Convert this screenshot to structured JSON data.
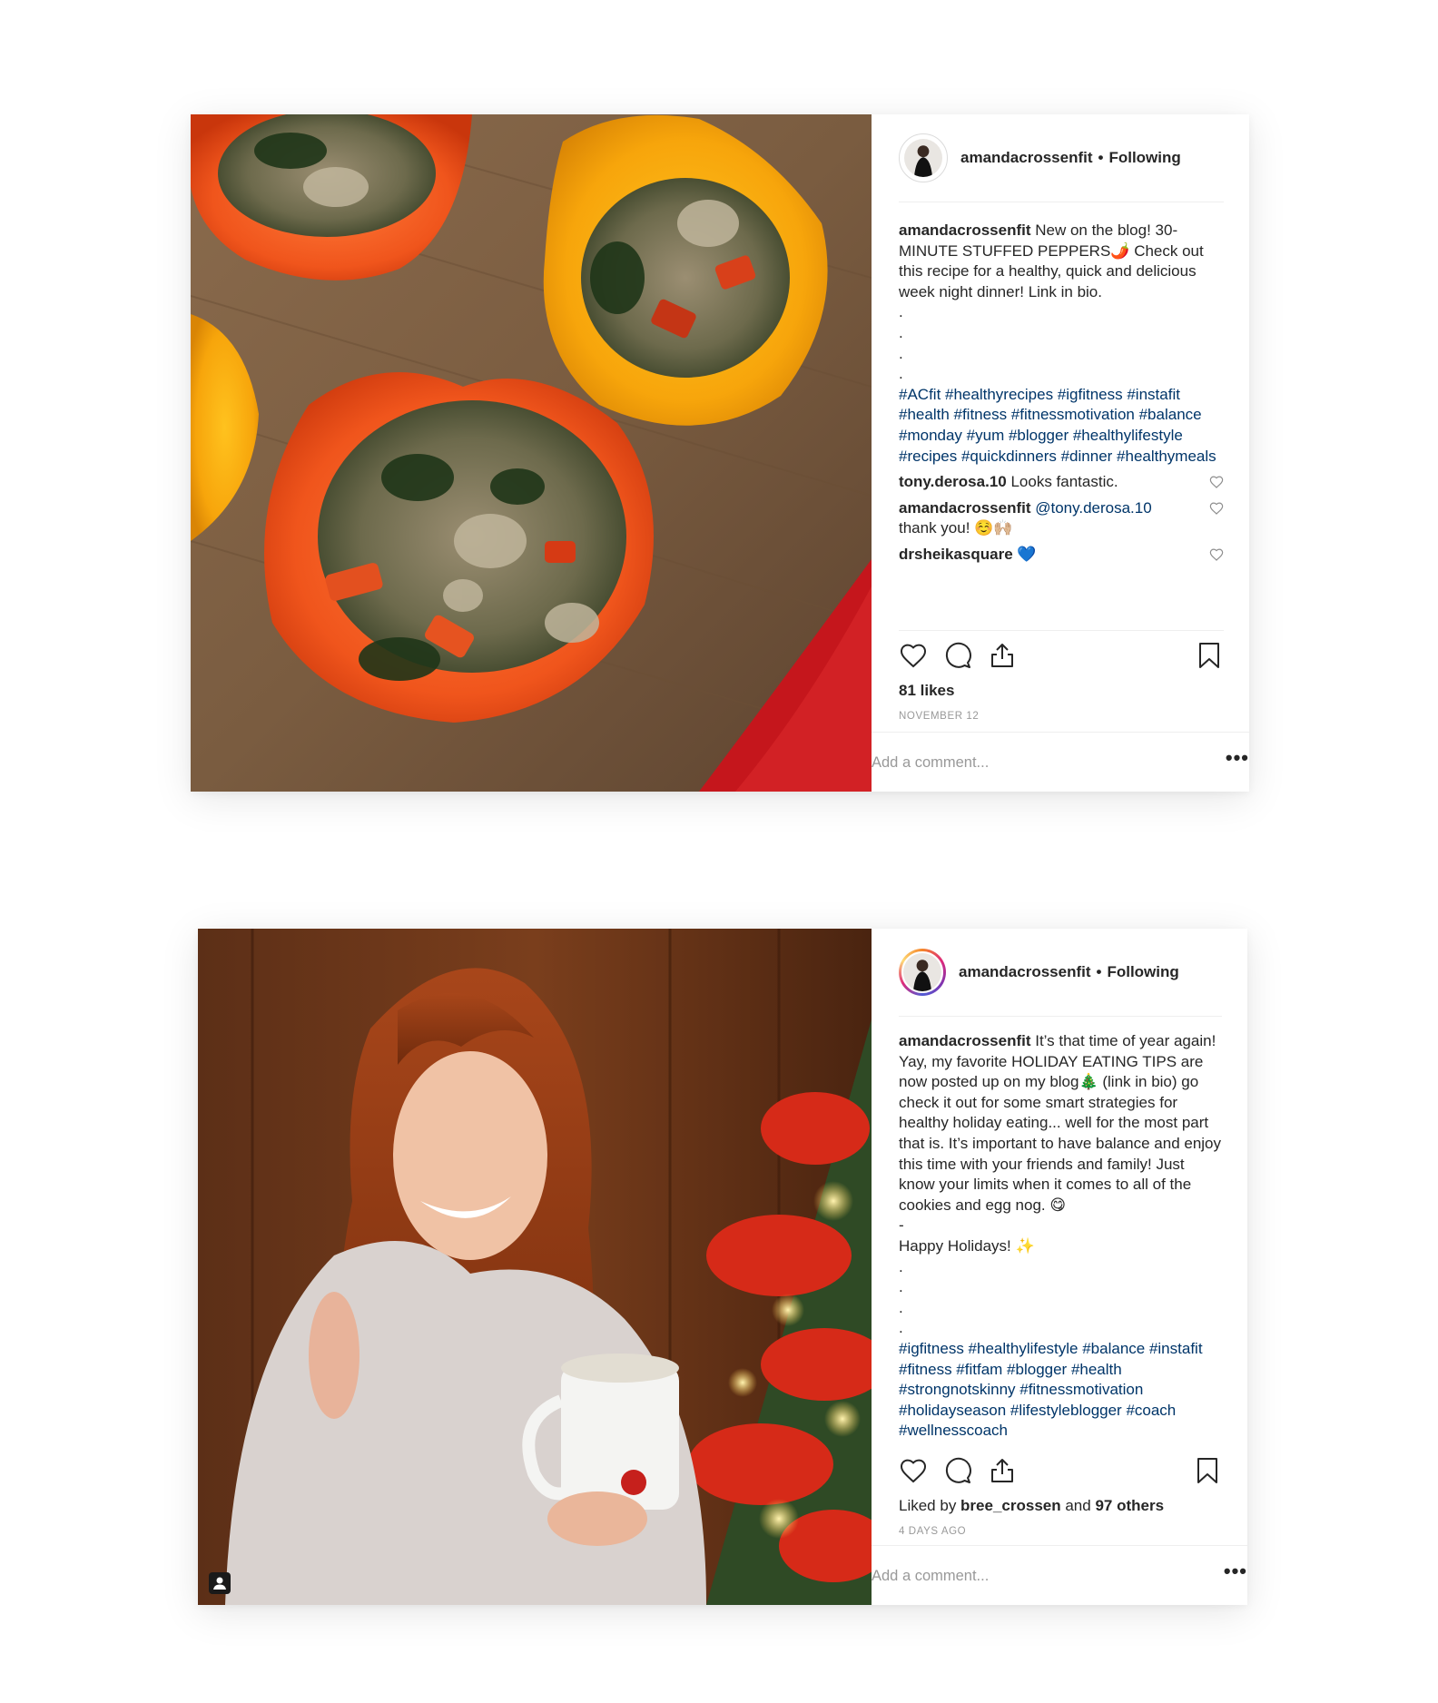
{
  "posts": [
    {
      "username": "amandacrossenfit",
      "follow_status": "Following",
      "caption_user": "amandacrossenfit",
      "caption_text": " New on the blog! 30-MINUTE STUFFED PEPPERS🌶️ Check out this recipe for a healthy, quick and delicious week night dinner! Link in bio.\n.\n.\n.\n.",
      "hashtags": "#ACfit #healthyrecipes #igfitness #instafit #health #fitness #fitnessmotivation #balance #monday #yum #blogger #healthylifestyle #recipes #quickdinners #dinner #healthymeals",
      "comments": [
        {
          "user": "tony.derosa.10",
          "mention": "",
          "text": " Looks fantastic."
        },
        {
          "user": "amandacrossenfit",
          "mention": " @tony.derosa.10",
          "text": " thank you! ☺️🙌🏼"
        },
        {
          "user": "drsheikasquare",
          "mention": "",
          "text": " 💙"
        }
      ],
      "likes_label": "81 likes",
      "date": "NOVEMBER 12",
      "add_comment_placeholder": "Add a comment...",
      "more_label": "•••"
    },
    {
      "username": "amandacrossenfit",
      "follow_status": "Following",
      "caption_user": "amandacrossenfit",
      "caption_text": " It’s that time of year again! Yay, my favorite HOLIDAY EATING TIPS are now posted up on my blog🎄 (link in bio) go check it out for some smart strategies for healthy holiday eating... well for the most part that is. It’s important to have balance and enjoy this time with your friends and family! Just know your limits when it comes to all of the cookies and egg nog. 😋\n-\nHappy Holidays! ✨\n.\n.\n.\n.",
      "hashtags": "#igfitness #healthylifestyle #balance #instafit #fitness #fitfam #blogger #health #strongnotskinny #fitnessmotivation #holidayseason #lifestyleblogger #coach #wellnesscoach",
      "liked_by_prefix": "Liked by ",
      "liked_by_user": "bree_crossen",
      "liked_by_and": " and ",
      "liked_by_others": "97 others",
      "date": "4 DAYS AGO",
      "add_comment_placeholder": "Add a comment...",
      "more_label": "•••"
    }
  ],
  "icons": {
    "like": "heart-icon",
    "comment": "comment-icon",
    "share": "share-icon",
    "save": "bookmark-icon",
    "tagged": "person-tag-icon"
  }
}
